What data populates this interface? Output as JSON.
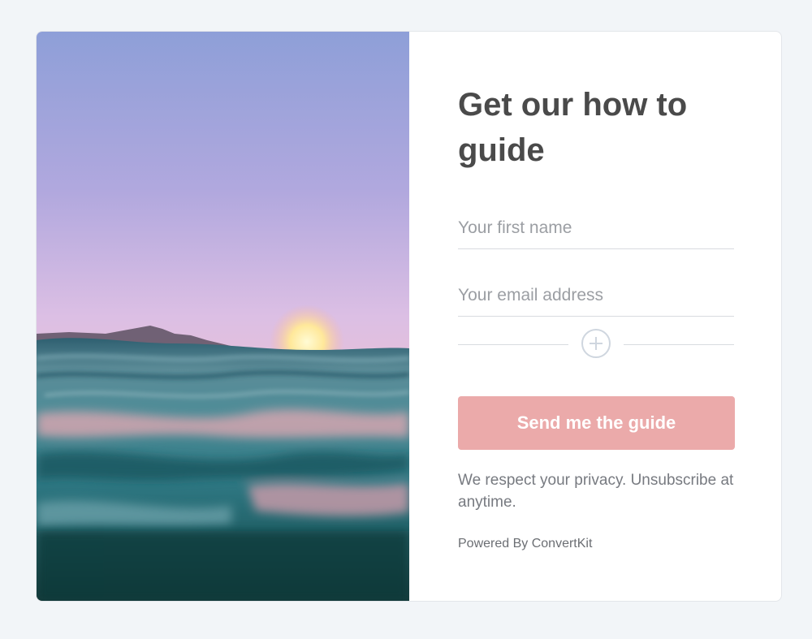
{
  "form": {
    "headline": "Get our how to guide",
    "first_name_placeholder": "Your first name",
    "email_placeholder": "Your email address",
    "add_field_icon": "plus-circle-icon",
    "submit_label": "Send me the guide",
    "privacy_text": "We respect your privacy. Unsubscribe at anytime.",
    "powered_by": "Powered By ConvertKit"
  },
  "hero_image": {
    "subject": "ocean-sunset-photo"
  },
  "colors": {
    "page_background": "#f2f5f8",
    "card_background": "#ffffff",
    "headline": "#4a4a4a",
    "button_background": "#ebaaaa",
    "button_text": "#ffffff",
    "muted_text": "#777a80",
    "input_border": "#d8dbe0"
  }
}
